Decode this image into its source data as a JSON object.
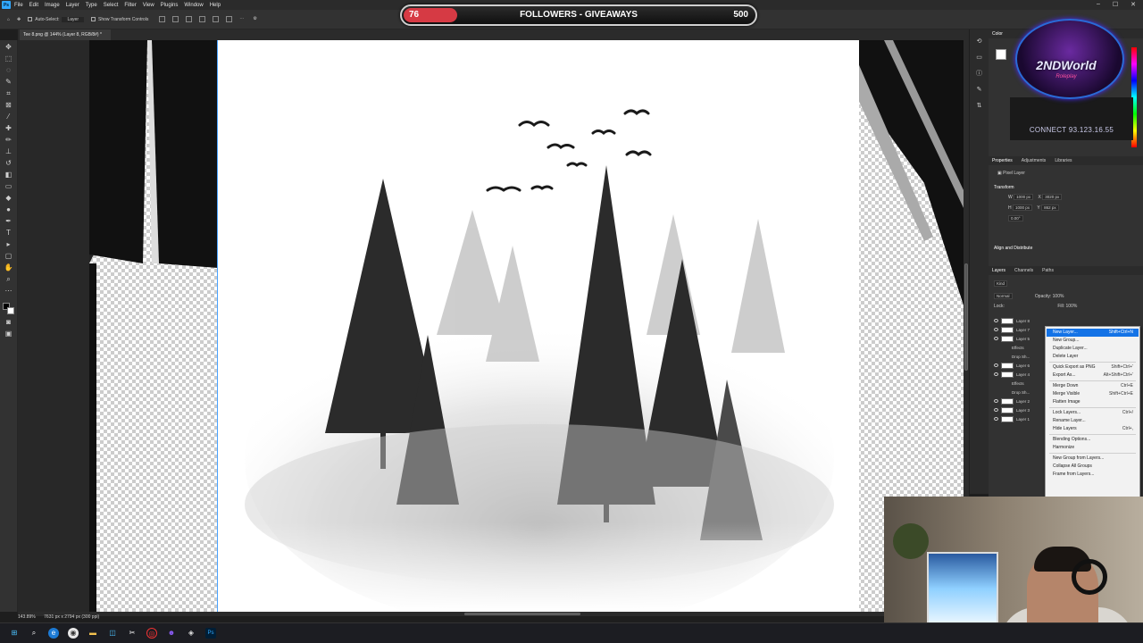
{
  "menubar": {
    "app_icon": "Ps",
    "items": [
      "File",
      "Edit",
      "Image",
      "Layer",
      "Type",
      "Select",
      "Filter",
      "View",
      "Plugins",
      "Window",
      "Help"
    ]
  },
  "optionsbar": {
    "auto_select_label": "Auto-Select:",
    "auto_select_target": "Layer",
    "transform_controls_label": "Show Transform Controls"
  },
  "banner": {
    "left_value": "76",
    "title": "FOLLOWERS - GIVEAWAYS",
    "right_value": "500",
    "progress_fraction": 0.152,
    "fill_color": "#d63a44"
  },
  "document": {
    "tab_title": "Tee 8.png @ 144% (Layer 8, RGB/8#) *",
    "status_zoom": "143.89%",
    "status_info": "7631 px x 2794 px (300 ppi)"
  },
  "overlay_logo": {
    "brand": "2NDWorld",
    "subtitle": "Roleplay",
    "connect": "CONNECT 93.123.16.55"
  },
  "panels": {
    "color_tab": "Color",
    "properties_tabs": [
      "Properties",
      "Adjustments",
      "Libraries"
    ],
    "pixel_layer_label": "Pixel Layer",
    "transform_label": "Transform",
    "w_label": "W",
    "w_value": "1000 px",
    "x_label": "X",
    "x_value": "3020 px",
    "h_label": "H",
    "h_value": "1000 px",
    "y_label": "Y",
    "y_value": "862 px",
    "angle_value": "0.00°",
    "align_label": "Align and Distribute",
    "layers_tabs": [
      "Layers",
      "Channels",
      "Paths"
    ],
    "kind_label": "Kind",
    "blend_mode": "Normal",
    "opacity_label": "Opacity:",
    "opacity_value": "100%",
    "lock_label": "Lock:",
    "fill_label": "Fill:",
    "fill_value": "100%",
    "layers": [
      "Layer 8",
      "Layer 7",
      "Layer 5",
      "Effects",
      "Drop Sh...",
      "Layer 6",
      "Layer 4",
      "Effects",
      "Drop Sh...",
      "Layer 2",
      "Layer 3",
      "Layer 1"
    ]
  },
  "context_menu": {
    "items": [
      {
        "label": "New Layer...",
        "shortcut": "Shift+Ctrl+N",
        "highlight": true
      },
      {
        "label": "New Group...",
        "shortcut": ""
      },
      {
        "label": "Duplicate Layer...",
        "shortcut": ""
      },
      {
        "label": "Delete Layer",
        "shortcut": ""
      },
      {
        "sep": true
      },
      {
        "label": "Quick Export as PNG",
        "shortcut": "Shift+Ctrl+'"
      },
      {
        "label": "Export As...",
        "shortcut": "Alt+Shift+Ctrl+'"
      },
      {
        "sep": true
      },
      {
        "label": "Merge Down",
        "shortcut": "Ctrl+E"
      },
      {
        "label": "Merge Visible",
        "shortcut": "Shift+Ctrl+E"
      },
      {
        "label": "Flatten Image",
        "shortcut": ""
      },
      {
        "sep": true
      },
      {
        "label": "Lock Layers...",
        "shortcut": "Ctrl+/"
      },
      {
        "label": "Rename Layer...",
        "shortcut": ""
      },
      {
        "label": "Hide Layers",
        "shortcut": "Ctrl+,"
      },
      {
        "sep": true
      },
      {
        "label": "Blending Options...",
        "shortcut": ""
      },
      {
        "label": "Harmonize",
        "shortcut": ""
      },
      {
        "sep": true
      },
      {
        "label": "New Group from Layers...",
        "shortcut": ""
      },
      {
        "label": "Collapse All Groups",
        "shortcut": ""
      },
      {
        "label": "Frame from Layers...",
        "shortcut": ""
      }
    ]
  },
  "colors": {
    "accent": "#1473e6",
    "photoshop_blue": "#31a8ff"
  }
}
